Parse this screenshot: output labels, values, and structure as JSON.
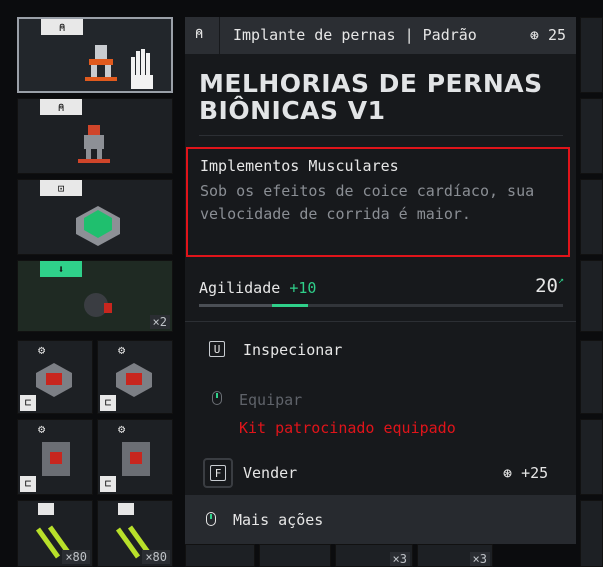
{
  "header": {
    "category": "Implante de pernas | Padrão",
    "cost": "25",
    "cost_icon": "eddies-icon"
  },
  "item": {
    "name": "MELHORIAS DE PERNAS BIÔNICAS V1"
  },
  "perk": {
    "title": "Implementos Musculares",
    "description": "Sob os efeitos de coice cardíaco, sua velocidade de corrida é maior."
  },
  "stat": {
    "label": "Agilidade",
    "bonus": "+10",
    "value": "20",
    "fill_fraction": 0.2,
    "bonus_fraction": 0.1
  },
  "actions": {
    "inspect": {
      "key": "U",
      "label": "Inspecionar"
    },
    "equip": {
      "label": "Equipar",
      "warning": "Kit patrocinado equipado"
    },
    "sell": {
      "key": "F",
      "label": "Vender",
      "price": "+25"
    },
    "more": {
      "label": "Mais ações"
    }
  },
  "inventory": {
    "qty_grenade": "×2",
    "qty_ammo_a": "×80",
    "qty_ammo_b": "×80",
    "qty_strip_a": "×3",
    "qty_strip_b": "×3"
  },
  "colors": {
    "accent_green": "#2fd08a",
    "highlight_red": "#e0141a",
    "panel_bg": "#17191c"
  }
}
